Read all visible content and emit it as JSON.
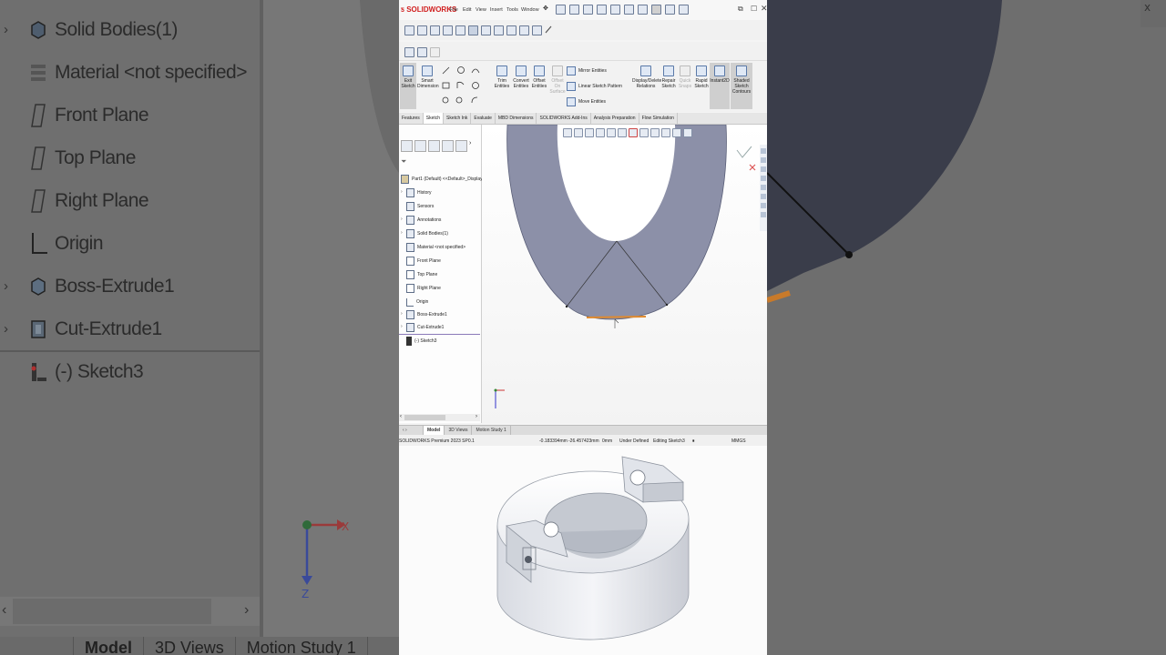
{
  "background_tree": {
    "items": [
      {
        "label": "Solid Bodies(1)",
        "icon": "solid-bodies-icon",
        "expandable": true
      },
      {
        "label": "Material <not specified>",
        "icon": "material-icon",
        "expandable": false
      },
      {
        "label": "Front Plane",
        "icon": "plane-icon",
        "expandable": false
      },
      {
        "label": "Top Plane",
        "icon": "plane-icon",
        "expandable": false
      },
      {
        "label": "Right Plane",
        "icon": "plane-icon",
        "expandable": false
      },
      {
        "label": "Origin",
        "icon": "origin-icon",
        "expandable": false
      },
      {
        "label": "Boss-Extrude1",
        "icon": "boss-extrude-icon",
        "expandable": true
      },
      {
        "label": "Cut-Extrude1",
        "icon": "cut-extrude-icon",
        "expandable": true
      },
      {
        "label": "(-) Sketch3",
        "icon": "sketch-icon",
        "expandable": false
      }
    ],
    "tabs": [
      "Model",
      "3D Views",
      "Motion Study 1"
    ]
  },
  "app": {
    "logo": "SOLIDWORKS",
    "menus": [
      "File",
      "Edit",
      "View",
      "Insert",
      "Tools",
      "Window"
    ],
    "ribbon": {
      "exit_sketch": "Exit Sketch",
      "smart_dimension": "Smart Dimension",
      "trim_entities": "Trim Entities",
      "convert_entities": "Convert Entities",
      "offset_entities": "Offset Entities",
      "offset_on_surface": "Offset On Surface",
      "mirror_entities": "Mirror Entities",
      "linear_sketch_pattern": "Linear Sketch Pattern",
      "move_entities": "Move Entities",
      "display_delete_relations": "Display/Delete Relations",
      "repair_sketch": "Repair Sketch",
      "quick_snaps": "Quick Snaps",
      "rapid_sketch": "Rapid Sketch",
      "instant2d": "Instant2D",
      "shaded_sketch_contours": "Shaded Sketch Contours"
    },
    "command_tabs": [
      "Features",
      "Sketch",
      "Sketch Ink",
      "Evaluate",
      "MBD Dimensions",
      "SOLIDWORKS Add-Ins",
      "Analysis Preparation",
      "Flow Simulation"
    ],
    "selected_command_tab": "Sketch",
    "tree": {
      "root": "Part1 (Default) <<Default>_Display St",
      "items": [
        {
          "label": "History",
          "expandable": true
        },
        {
          "label": "Sensors",
          "expandable": false
        },
        {
          "label": "Annotations",
          "expandable": true
        },
        {
          "label": "Solid Bodies(1)",
          "expandable": true
        },
        {
          "label": "Material <not specified>",
          "expandable": false
        },
        {
          "label": "Front Plane",
          "expandable": false
        },
        {
          "label": "Top Plane",
          "expandable": false
        },
        {
          "label": "Right Plane",
          "expandable": false
        },
        {
          "label": "Origin",
          "expandable": false
        },
        {
          "label": "Boss-Extrude1",
          "expandable": true
        },
        {
          "label": "Cut-Extrude1",
          "expandable": true
        },
        {
          "label": "(-) Sketch3",
          "expandable": false
        }
      ]
    },
    "bottom_tabs": [
      "Model",
      "3D Views",
      "Motion Study 1"
    ],
    "status": {
      "product": "SOLIDWORKS Premium 2023 SP0.1",
      "x": "-0.183394mm",
      "y": "-26.457423mm",
      "z": "0mm",
      "definition": "Under Defined",
      "editing": "Editing Sketch3",
      "units": "MMGS"
    }
  },
  "colors": {
    "part_face": "#8c90a8",
    "sketch_highlight": "#e08a2e",
    "logo_red": "#d12020",
    "selection_blue": "#dde7f6"
  }
}
